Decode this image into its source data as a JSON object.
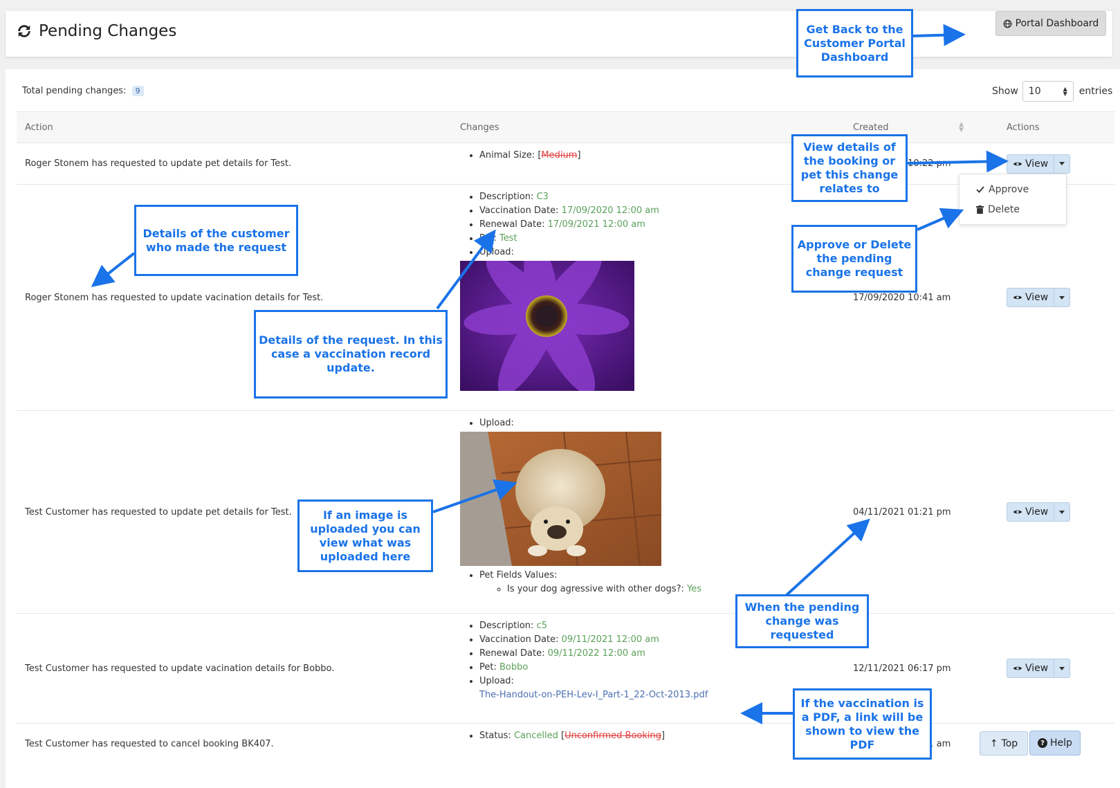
{
  "header": {
    "title": "Pending Changes",
    "portal_button": "Portal Dashboard"
  },
  "summary": {
    "total_label": "Total pending changes:",
    "total_count": "9",
    "show_label": "Show",
    "entries_value": "10",
    "entries_label": "entries"
  },
  "table": {
    "columns": [
      "Action",
      "Changes",
      "Created",
      "Actions"
    ],
    "view_label": "View",
    "rows": [
      {
        "action": "Roger Stonem has requested to update pet details for Test.",
        "created": "17/09/2020 10:22 pm",
        "changes": [
          {
            "label": "Animal Size:",
            "old": "Medium"
          }
        ]
      },
      {
        "action": "Roger Stonem has requested to update vacination details for Test.",
        "created": "17/09/2020 10:41 am",
        "changes": [
          {
            "label": "Description:",
            "value": "C3"
          },
          {
            "label": "Vaccination Date:",
            "value": "17/09/2020 12:00 am"
          },
          {
            "label": "Renewal Date:",
            "value": "17/09/2021 12:00 am"
          },
          {
            "label": "Pet:",
            "value": "Test"
          },
          {
            "label": "Upload:"
          }
        ]
      },
      {
        "action": "Test Customer has requested to update pet details for Test.",
        "created": "04/11/2021 01:21 pm",
        "changes": [
          {
            "label": "Upload:"
          },
          {
            "label": "Pet Fields Values:"
          },
          {
            "label": "Is your dog agressive with other dogs?:",
            "value": "Yes"
          }
        ]
      },
      {
        "action": "Test Customer has requested to update vacination details for Bobbo.",
        "created": "12/11/2021 06:17 pm",
        "changes": [
          {
            "label": "Description:",
            "value": "c5"
          },
          {
            "label": "Vaccination Date:",
            "value": "09/11/2021 12:00 am"
          },
          {
            "label": "Renewal Date:",
            "value": "09/11/2022 12:00 am"
          },
          {
            "label": "Pet:",
            "value": "Bobbo"
          },
          {
            "label": "Upload:",
            "link": "The-Handout-on-PEH-Lev-I_Part-1_22-Oct-2013.pdf"
          }
        ]
      },
      {
        "action": "Test Customer has requested to cancel booking BK407.",
        "created": "04/11/2022 10:11 am",
        "changes": [
          {
            "label": "Status:",
            "value": "Cancelled",
            "old": "Unconfirmed Booking"
          }
        ]
      }
    ]
  },
  "dropdown": {
    "approve": "Approve",
    "delete": "Delete"
  },
  "annotations": {
    "portal": "Get Back to the Customer Portal Dashboard",
    "view": "View details of the booking or pet this change relates to",
    "customer": "Details of the customer who made the request",
    "approve": "Approve or Delete the pending change request",
    "request": "Details of the request. In this case a vaccination record update.",
    "image": "If an image is uploaded you can view what was uploaded here",
    "created": "When the pending change was requested",
    "pdf": "If the vaccination is a PDF, a link will be shown to view the PDF"
  },
  "floating": {
    "top": "Top",
    "help": "Help"
  },
  "colors": {
    "accent": "#1a73e8",
    "view_button": "#d3e4f5",
    "new_value": "#5aa05a",
    "old_value": "#e04040"
  }
}
